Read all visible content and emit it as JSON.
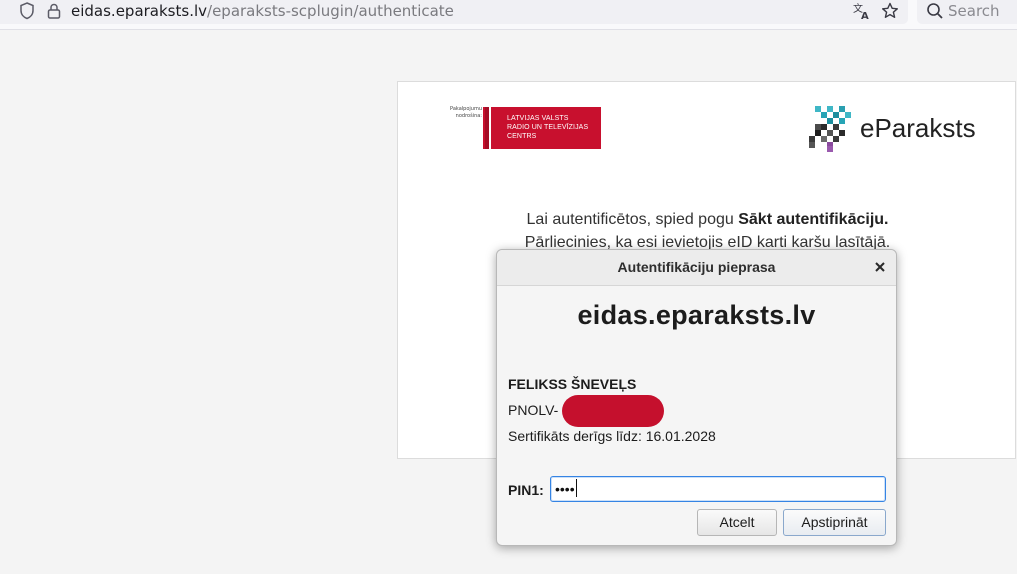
{
  "browser": {
    "url_domain": "eidas.eparaksts.lv",
    "url_path": "/eparaksts-scplugin/authenticate",
    "search_placeholder": "Search",
    "icons": [
      "shield-icon",
      "lock-icon",
      "translate-icon",
      "star-icon",
      "search-icon"
    ]
  },
  "page": {
    "provider_note": "Pakalpojumu nodrošina:",
    "lvrtc_logo_text": "LATVIJAS VALSTS\nRADIO UN TELEVĪZIJAS\nCENTRS",
    "brand": "eParaksts",
    "instruction_prefix": "Lai autentificētos, spied pogu ",
    "instruction_bold": "Sākt autentifikāciju.",
    "instruction_line2": "Pārliecinies, ka esi ievietojis eID karti karšu lasītājā.",
    "colors": {
      "lvrtc_red": "#c8102e"
    }
  },
  "dialog": {
    "title": "Autentifikāciju pieprasa",
    "domain": "eidas.eparaksts.lv",
    "cert_holder": "FELIKSS ŠNEVEĻS",
    "cert_id_prefix": "PNOLV-",
    "cert_validity": "Sertifikāts derīgs līdz: 16.01.2028",
    "pin_label": "PIN1:",
    "pin_value": "••••",
    "cancel_label": "Atcelt",
    "confirm_label": "Apstiprināt",
    "colors": {
      "redaction": "#c5102d",
      "focus": "#3584e4"
    }
  }
}
